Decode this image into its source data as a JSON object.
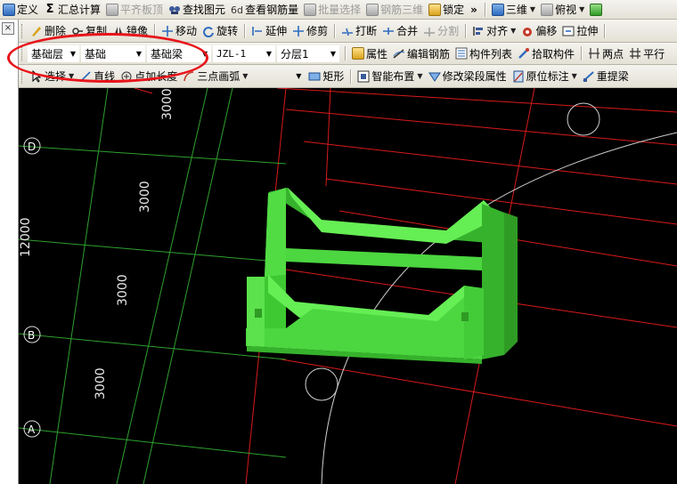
{
  "toolbar1": {
    "items": [
      {
        "label": "定义",
        "icon": "define-icon"
      },
      {
        "label": "汇总计算",
        "icon": "sigma-icon"
      },
      {
        "label": "平齐板顶",
        "icon": "align-slab-top-icon",
        "disabled": true
      },
      {
        "label": "查找图元",
        "icon": "find-element-icon"
      },
      {
        "label": "查看钢筋量",
        "icon": "view-rebar-icon"
      },
      {
        "label": "批量选择",
        "icon": "batch-select-icon",
        "disabled": true
      },
      {
        "label": "钢筋三维",
        "icon": "rebar-3d-icon",
        "disabled": true
      },
      {
        "label": "锁定",
        "icon": "lock-icon"
      }
    ],
    "more": "»",
    "view3d_label": "三维",
    "viewmode_label": "俯视"
  },
  "toolbar2": {
    "items": [
      {
        "label": "删除",
        "icon": "delete-icon"
      },
      {
        "label": "复制",
        "icon": "copy-icon"
      },
      {
        "label": "镜像",
        "icon": "mirror-icon"
      },
      {
        "label": "移动",
        "icon": "move-icon"
      },
      {
        "label": "旋转",
        "icon": "rotate-icon"
      },
      {
        "label": "延伸",
        "icon": "extend-icon"
      },
      {
        "label": "修剪",
        "icon": "trim-icon"
      },
      {
        "label": "打断",
        "icon": "break-icon"
      },
      {
        "label": "合并",
        "icon": "merge-icon"
      },
      {
        "label": "分割",
        "icon": "split-icon",
        "disabled": true
      },
      {
        "label": "对齐",
        "icon": "align-icon"
      },
      {
        "label": "偏移",
        "icon": "offset-icon"
      },
      {
        "label": "拉伸",
        "icon": "stretch-icon"
      }
    ]
  },
  "toolbar3": {
    "selectors": {
      "floor": "基础层",
      "category": "基础",
      "component_type": "基础梁",
      "component": "JZL-1",
      "layer": "分层1"
    },
    "items": [
      {
        "label": "属性",
        "icon": "properties-icon"
      },
      {
        "label": "编辑钢筋",
        "icon": "edit-rebar-icon"
      },
      {
        "label": "构件列表",
        "icon": "component-list-icon"
      },
      {
        "label": "拾取构件",
        "icon": "pick-component-icon"
      },
      {
        "label": "两点",
        "icon": "two-point-icon"
      },
      {
        "label": "平行",
        "icon": "parallel-icon"
      }
    ]
  },
  "toolbar4": {
    "items": [
      {
        "label": "选择",
        "icon": "select-arrow-icon"
      },
      {
        "label": "直线",
        "icon": "line-icon"
      },
      {
        "label": "点加长度",
        "icon": "point-length-icon"
      },
      {
        "label": "三点画弧",
        "icon": "three-point-arc-icon"
      },
      {
        "label": "矩形",
        "icon": "rectangle-icon"
      },
      {
        "label": "智能布置",
        "icon": "smart-layout-icon"
      },
      {
        "label": "修改梁段属性",
        "icon": "modify-beam-segment-icon"
      },
      {
        "label": "原位标注",
        "icon": "in-place-annotation-icon"
      },
      {
        "label": "重提梁",
        "icon": "re-extract-beam-icon"
      }
    ]
  },
  "left_strip": {
    "close": "×"
  },
  "viewport": {
    "axis_labels": [
      "D",
      "B",
      "A"
    ],
    "dimensions": [
      "3000",
      "3000",
      "3000",
      "3000"
    ],
    "overall_dimension": "12000"
  },
  "colors": {
    "viewport_bg": "#000000",
    "grid_red": "#d81a1a",
    "grid_green": "#2ea02e",
    "beam_light": "#66ee55",
    "beam_mid": "#4cd640",
    "beam_dark": "#36b22c",
    "highlight": "#e8141a"
  }
}
